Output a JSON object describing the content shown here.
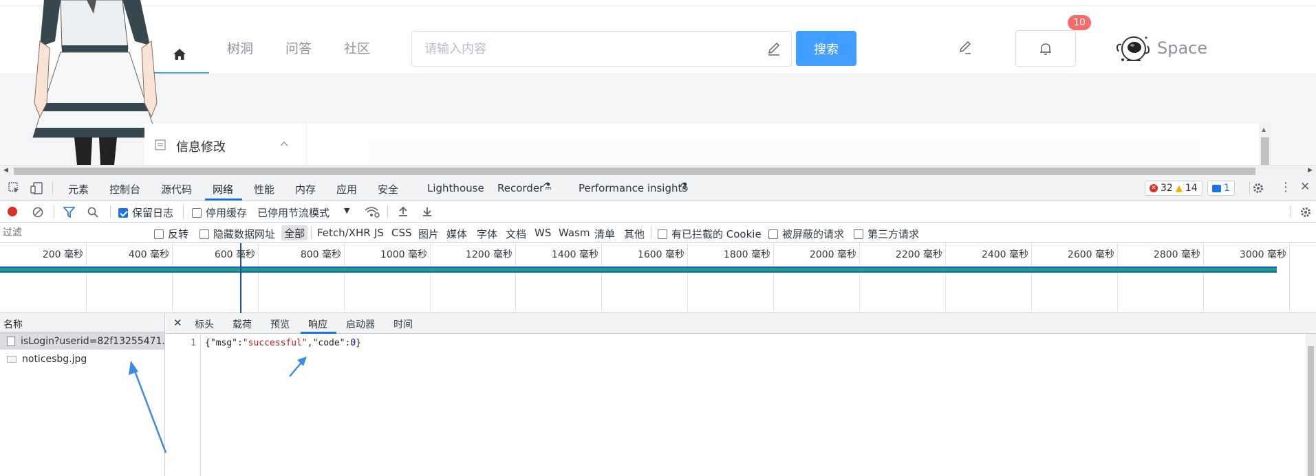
{
  "site": {
    "nav": [
      "树洞",
      "问答",
      "社区"
    ],
    "search_placeholder": "请输入内容",
    "search_button": "搜索",
    "notification_count": "10",
    "brand": "Space",
    "side_menu_label": "信息修改"
  },
  "devtools": {
    "tabs": [
      "元素",
      "控制台",
      "源代码",
      "网络",
      "性能",
      "内存",
      "应用",
      "安全",
      "Lighthouse",
      "Recorder",
      "Performance insights"
    ],
    "active_tab": "网络",
    "errors": "32",
    "warnings": "14",
    "messages": "1",
    "toolbar": {
      "preserve_log": "保留日志",
      "disable_cache": "停用缓存",
      "throttle": "已停用节流模式"
    },
    "filter": {
      "placeholder": "过滤",
      "invert": "反转",
      "hide_data_urls": "隐藏数据网址",
      "types": [
        "全部",
        "Fetch/XHR",
        "JS",
        "CSS",
        "图片",
        "媒体",
        "字体",
        "文档",
        "WS",
        "Wasm",
        "清单",
        "其他"
      ],
      "blocked_cookies": "有已拦截的 Cookie",
      "blocked_requests": "被屏蔽的请求",
      "third_party": "第三方请求"
    },
    "timeline_ticks": [
      "200 毫秒",
      "400 毫秒",
      "600 毫秒",
      "800 毫秒",
      "1000 毫秒",
      "1200 毫秒",
      "1400 毫秒",
      "1600 毫秒",
      "1800 毫秒",
      "2000 毫秒",
      "2200 毫秒",
      "2400 毫秒",
      "2600 毫秒",
      "2800 毫秒",
      "3000 毫秒"
    ],
    "names_header": "名称",
    "requests": [
      "isLogin?userid=82f13255471...",
      "noticesbg.jpg"
    ],
    "detail_tabs": [
      "标头",
      "载荷",
      "预览",
      "响应",
      "启动器",
      "时间"
    ],
    "active_detail_tab": "响应",
    "response": {
      "line_number": "1",
      "open": "{",
      "k1": "\"msg\"",
      "colon1": ":",
      "v1": "\"successful\"",
      "comma": ",",
      "k2": "\"code\"",
      "colon2": ":",
      "v2": "0",
      "close": "}"
    }
  }
}
